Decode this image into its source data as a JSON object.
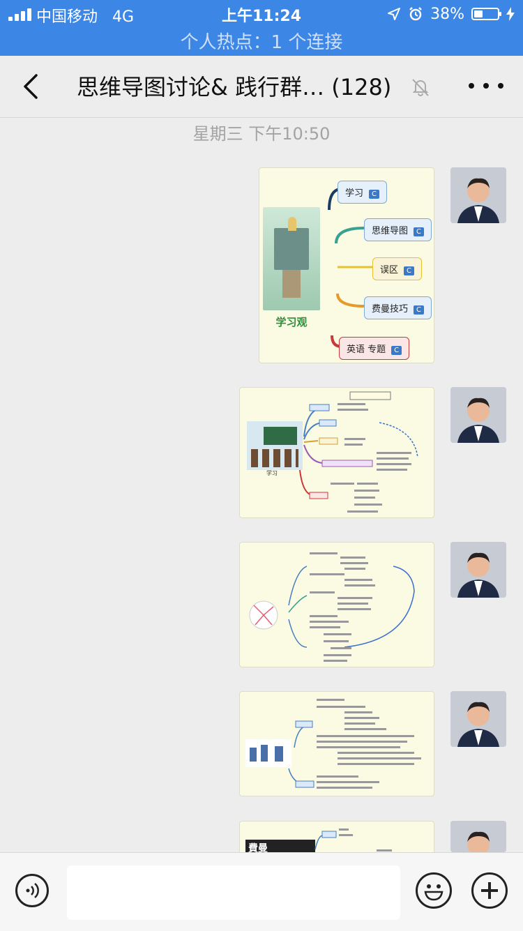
{
  "status_bar": {
    "carrier": "中国移动",
    "network": "4G",
    "time": "上午11:24",
    "battery_percent": "38%",
    "battery_level": 0.38,
    "hotspot_text": "个人热点：1 个连接"
  },
  "nav": {
    "title": "思维导图讨论& 践行群… (128)"
  },
  "chat": {
    "timestamp": "星期三 下午10:50",
    "messages": [
      {
        "type": "image",
        "mindmap": {
          "center_label": "学习观",
          "branches": [
            "学习",
            "思维导图",
            "误区",
            "费曼技巧",
            "英语 专题"
          ],
          "tag": "C"
        }
      },
      {
        "type": "image",
        "center_label": "学习"
      },
      {
        "type": "image"
      },
      {
        "type": "image"
      },
      {
        "type": "image",
        "top_text": "費曼"
      }
    ]
  },
  "colors": {
    "status_blue": "#3c86e6",
    "chat_bg": "#ededed",
    "bubble_bg": "#fbfbe4"
  }
}
